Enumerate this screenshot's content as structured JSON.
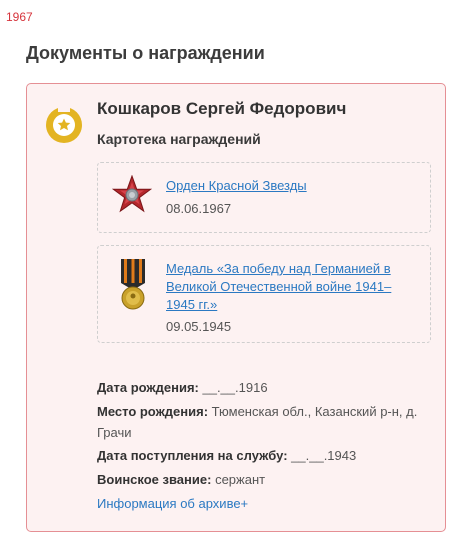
{
  "year": "1967",
  "section_title": "Документы о награждении",
  "card": {
    "name": "Кошкаров Сергей Федорович",
    "subtitle": "Картотека награждений",
    "awards": [
      {
        "title": "Орден Красной Звезды",
        "date": "08.06.1967",
        "icon": "red-star-order-icon"
      },
      {
        "title": "Медаль «За победу над Германией в Великой Отечественной войне 1941–1945 гг.»",
        "date": "09.05.1945",
        "icon": "victory-medal-icon"
      }
    ],
    "details": {
      "birth_date_label": "Дата рождения:",
      "birth_date_value": "__.__.1916",
      "birth_place_label": "Место рождения:",
      "birth_place_value": "Тюменская обл., Казанский р-н, д. Грачи",
      "service_label": "Дата поступления на службу:",
      "service_value": "__.__.1943",
      "rank_label": "Воинское звание:",
      "rank_value": "сержант"
    },
    "archive_link": "Информация об архиве+"
  },
  "colors": {
    "accent_red": "#d6343c",
    "card_border": "#e58f94",
    "card_bg": "#fdf2f2",
    "link": "#2b79c2",
    "badge_gold": "#e3b422"
  }
}
